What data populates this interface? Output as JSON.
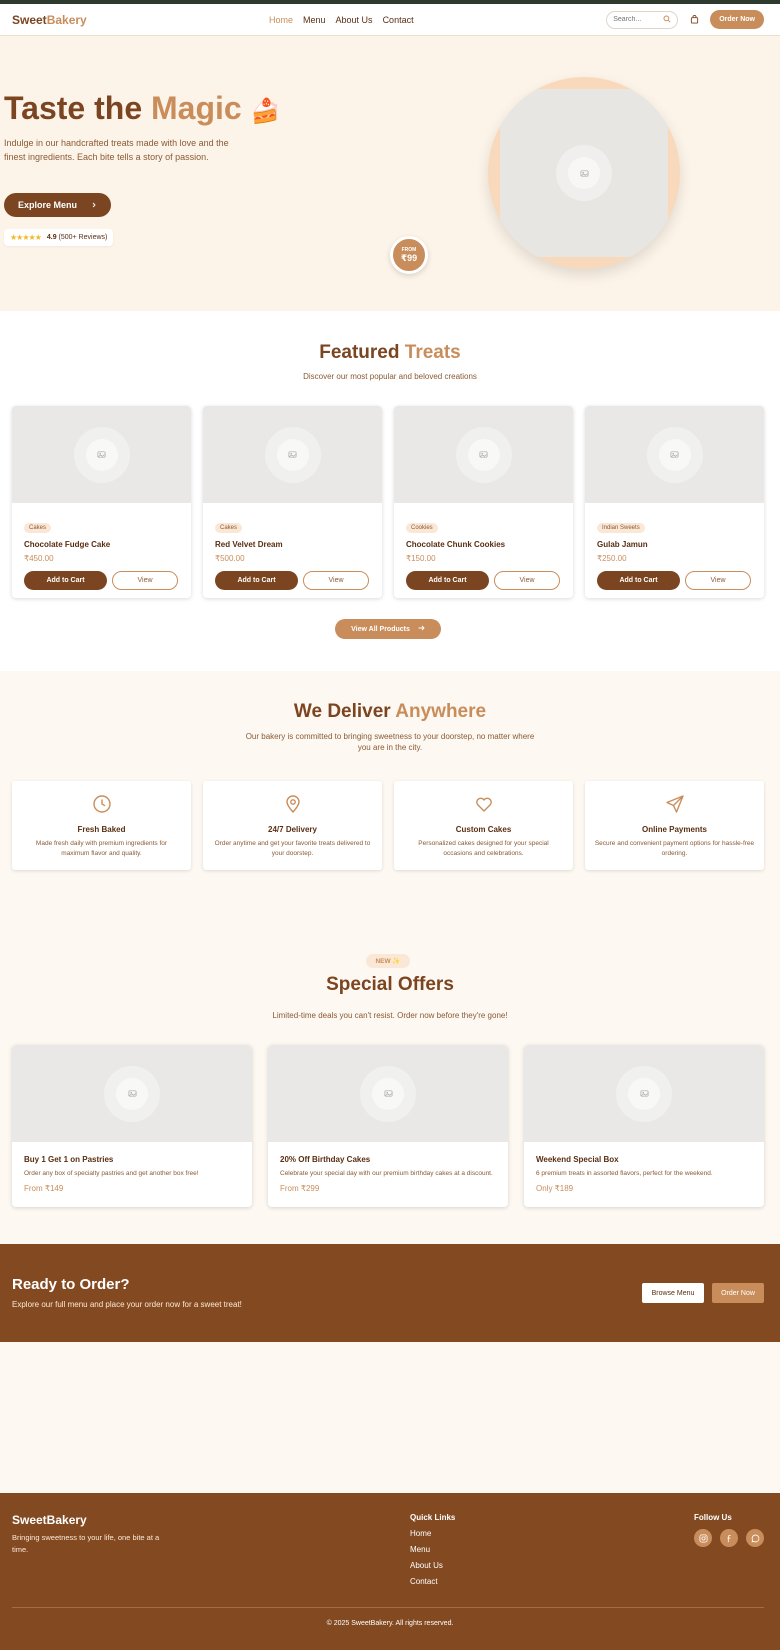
{
  "brand": {
    "name_part1": "Sweet",
    "name_part2": "Bakery",
    "accent_color": "#c98d5b",
    "primary_color": "#7a4520"
  },
  "nav": {
    "items": [
      "Home",
      "Menu",
      "About Us",
      "Contact"
    ],
    "active": "Home"
  },
  "header": {
    "search_placeholder": "Search...",
    "order_button": "Order Now",
    "search_icon": "search-icon",
    "cart_icon": "shopping-bag-icon"
  },
  "hero": {
    "title_part1": "Taste the ",
    "title_part2": "Magic",
    "title_emoji": "🍰",
    "description": "Indulge in our handcrafted treats made with love and the finest ingredients. Each bite tells a story of passion.",
    "explore_button": "Explore Menu",
    "rating_stars": "★★★★★",
    "rating_value": "4.9",
    "rating_count": "(500+ Reviews)",
    "badge_from": "FROM",
    "badge_price": "₹99"
  },
  "featured": {
    "title_part1": "Featured ",
    "title_part2": "Treats",
    "subtitle": "Discover our most popular and beloved creations",
    "products": [
      {
        "category": "Cakes",
        "name": "Chocolate Fudge Cake",
        "price": "₹450.00"
      },
      {
        "category": "Cakes",
        "name": "Red Velvet Dream",
        "price": "₹500.00"
      },
      {
        "category": "Cookies",
        "name": "Chocolate Chunk Cookies",
        "price": "₹150.00"
      },
      {
        "category": "Indian Sweets",
        "name": "Gulab Jamun",
        "price": "₹250.00"
      }
    ],
    "add_to_cart": "Add to Cart",
    "view": "View",
    "view_all": "View All Products"
  },
  "deliver": {
    "title_part1": "We Deliver ",
    "title_part2": "Anywhere",
    "subtitle": "Our bakery is committed to bringing sweetness to your doorstep, no matter where you are in the city.",
    "features": [
      {
        "icon": "clock-icon",
        "title": "Fresh Baked",
        "desc": "Made fresh daily with premium ingredients for maximum flavor and quality."
      },
      {
        "icon": "map-pin-icon",
        "title": "24/7 Delivery",
        "desc": "Order anytime and get your favorite treats delivered to your doorstep."
      },
      {
        "icon": "heart-icon",
        "title": "Custom Cakes",
        "desc": "Personalized cakes designed for your special occasions and celebrations."
      },
      {
        "icon": "send-icon",
        "title": "Online Payments",
        "desc": "Secure and convenient payment options for hassle-free ordering."
      }
    ]
  },
  "offers": {
    "badge": "NEW ✨",
    "title": "Special Offers",
    "subtitle": "Limited-time deals you can't resist. Order now before they're gone!",
    "items": [
      {
        "title": "Buy 1 Get 1 on Pastries",
        "desc": "Order any box of specialty pastries and get another box free!",
        "price": "From ₹149"
      },
      {
        "title": "20% Off Birthday Cakes",
        "desc": "Celebrate your special day with our premium birthday cakes at a discount.",
        "price": "From ₹299"
      },
      {
        "title": "Weekend Special Box",
        "desc": "6 premium treats in assorted flavors, perfect for the weekend.",
        "price": "Only ₹189"
      }
    ]
  },
  "cta": {
    "title": "Ready to Order?",
    "subtitle": "Explore our full menu and place your order now for a sweet treat!",
    "browse_button": "Browse Menu",
    "order_button": "Order Now"
  },
  "footer": {
    "brand": "SweetBakery",
    "tagline": "Bringing sweetness to your life, one bite at a time.",
    "quick_links_title": "Quick Links",
    "quick_links": [
      "Home",
      "Menu",
      "About Us",
      "Contact"
    ],
    "follow_title": "Follow Us",
    "socials": [
      "instagram-icon",
      "facebook-icon",
      "chat-icon"
    ],
    "copyright": "© 2025 SweetBakery. All rights reserved."
  }
}
